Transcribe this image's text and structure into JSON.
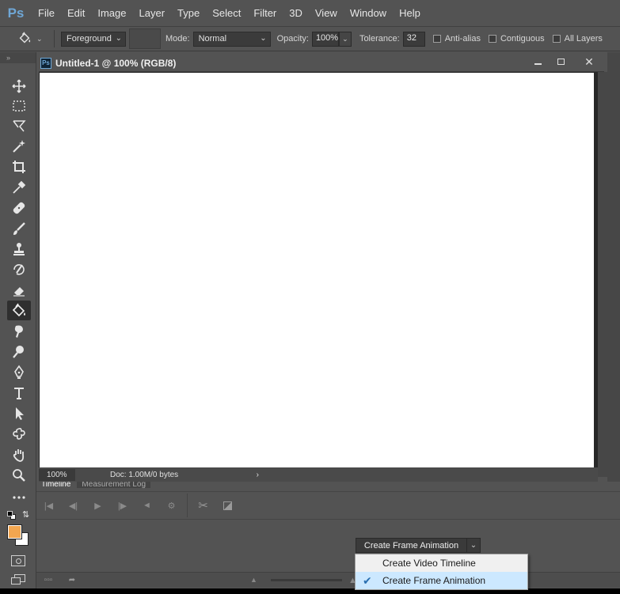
{
  "app": {
    "logo": "Ps",
    "menu": [
      "File",
      "Edit",
      "Image",
      "Layer",
      "Type",
      "Select",
      "Filter",
      "3D",
      "View",
      "Window",
      "Help"
    ]
  },
  "options": {
    "fill_source": "Foreground",
    "mode_label": "Mode:",
    "mode_value": "Normal",
    "opacity_label": "Opacity:",
    "opacity_value": "100%",
    "tolerance_label": "Tolerance:",
    "tolerance_value": "32",
    "antialias_label": "Anti-alias",
    "contiguous_label": "Contiguous",
    "all_layers_label": "All Layers"
  },
  "document": {
    "title": "Untitled-1 @ 100% (RGB/8)",
    "zoom": "100%",
    "doc_info": "Doc: 1.00M/0 bytes",
    "doc_info_arrow": "›"
  },
  "panel": {
    "tabs": [
      "Timeline",
      "Measurement Log"
    ],
    "create_button": "Create Frame Animation",
    "menu": [
      {
        "label": "Create Video Timeline",
        "selected": false
      },
      {
        "label": "Create Frame Animation",
        "selected": true
      }
    ]
  },
  "colors": {
    "foreground": "#f2a650",
    "background": "#ffffff",
    "accent": "#6fa7d6"
  },
  "tools": [
    "move-icon",
    "marquee-icon",
    "lasso-icon",
    "magic-wand-icon",
    "crop-icon",
    "eyedropper-icon",
    "healing-icon",
    "brush-icon",
    "stamp-icon",
    "history-brush-icon",
    "eraser-icon",
    "paint-bucket-icon",
    "smudge-icon",
    "dodge-icon",
    "pen-icon",
    "type-icon",
    "path-select-icon",
    "custom-shape-icon",
    "hand-icon",
    "zoom-icon",
    "more-tools-icon"
  ]
}
